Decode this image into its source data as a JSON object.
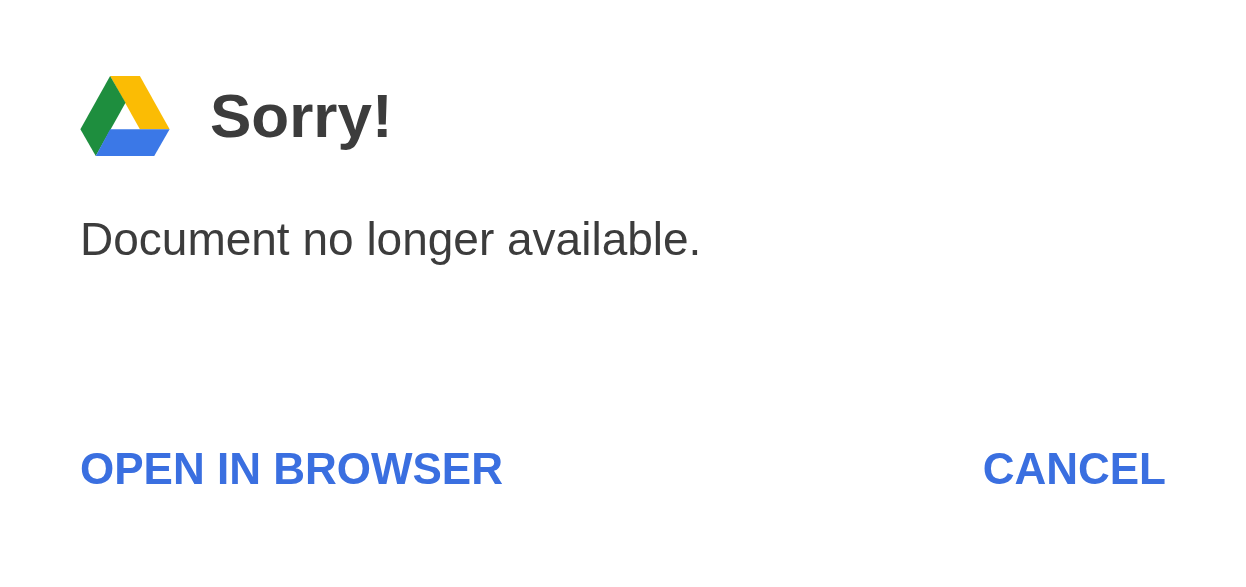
{
  "dialog": {
    "title": "Sorry!",
    "message": "Document no longer available.",
    "buttons": [
      {
        "label": "OPEN IN BROWSER"
      },
      {
        "label": "CANCEL"
      }
    ]
  }
}
